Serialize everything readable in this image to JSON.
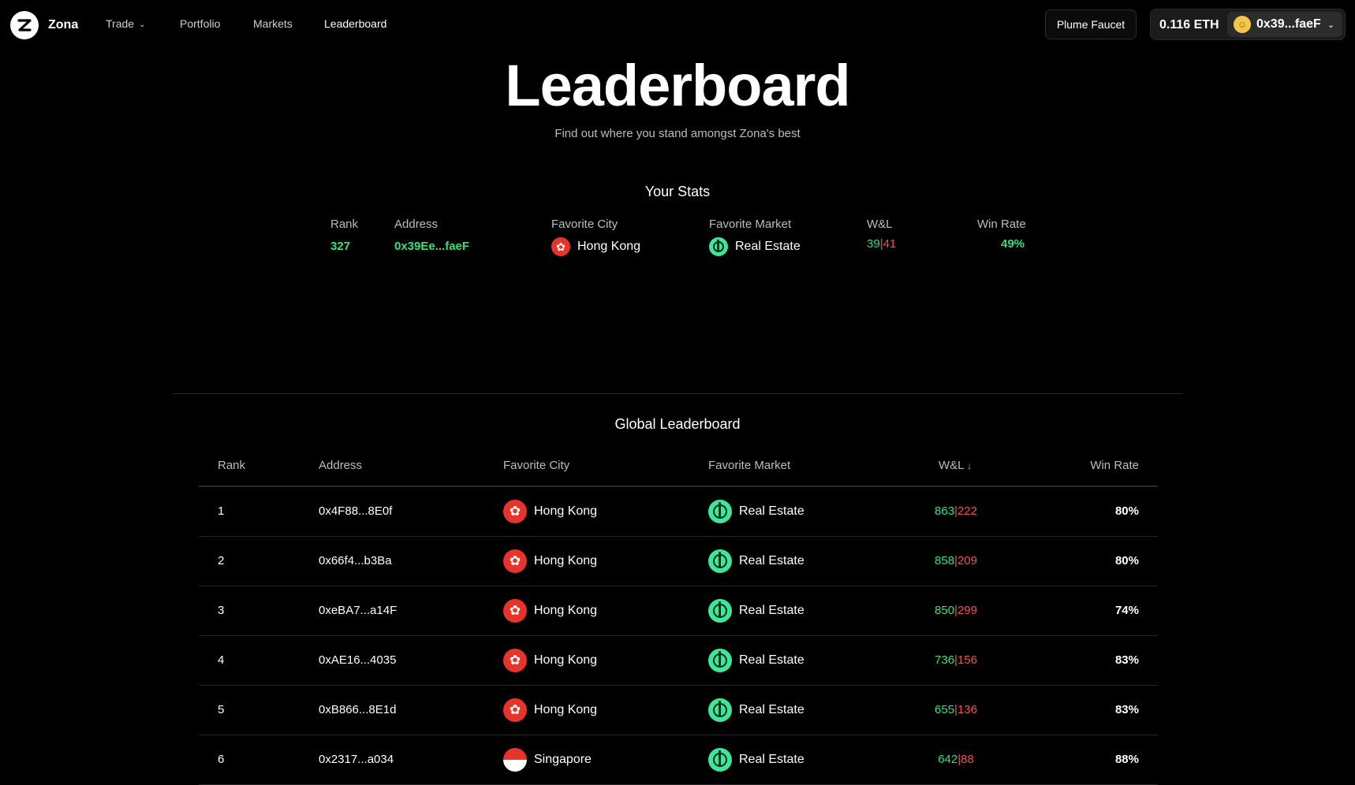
{
  "nav": {
    "brand": "Zona",
    "links": [
      {
        "label": "Trade",
        "has_dropdown": true
      },
      {
        "label": "Portfolio"
      },
      {
        "label": "Markets"
      },
      {
        "label": "Leaderboard",
        "active": true
      }
    ],
    "faucet_label": "Plume Faucet",
    "wallet": {
      "balance": "0.116 ETH",
      "address": "0x39...faeF"
    }
  },
  "hero": {
    "title": "Leaderboard",
    "subtitle": "Find out where you stand amongst Zona's best"
  },
  "your_stats": {
    "title": "Your Stats",
    "labels": {
      "rank": "Rank",
      "address": "Address",
      "city": "Favorite City",
      "market": "Favorite Market",
      "wl": "W&L",
      "rate": "Win Rate"
    },
    "rank": "327",
    "address": "0x39Ee...faeF",
    "city": "Hong Kong",
    "market": "Real Estate",
    "wins": "39",
    "losses": "41",
    "win_rate": "49%"
  },
  "global": {
    "title": "Global Leaderboard",
    "columns": {
      "rank": "Rank",
      "address": "Address",
      "city": "Favorite City",
      "market": "Favorite Market",
      "wl": "W&L",
      "rate": "Win Rate"
    },
    "sort_indicator": "↓",
    "rows": [
      {
        "rank": "1",
        "address": "0x4F88...8E0f",
        "city": "Hong Kong",
        "flag": "hong-kong-flag",
        "market": "Real Estate",
        "wins": "863",
        "losses": "222",
        "win_rate": "80%"
      },
      {
        "rank": "2",
        "address": "0x66f4...b3Ba",
        "city": "Hong Kong",
        "flag": "hong-kong-flag",
        "market": "Real Estate",
        "wins": "858",
        "losses": "209",
        "win_rate": "80%"
      },
      {
        "rank": "3",
        "address": "0xeBA7...a14F",
        "city": "Hong Kong",
        "flag": "hong-kong-flag",
        "market": "Real Estate",
        "wins": "850",
        "losses": "299",
        "win_rate": "74%"
      },
      {
        "rank": "4",
        "address": "0xAE16...4035",
        "city": "Hong Kong",
        "flag": "hong-kong-flag",
        "market": "Real Estate",
        "wins": "736",
        "losses": "156",
        "win_rate": "83%"
      },
      {
        "rank": "5",
        "address": "0xB866...8E1d",
        "city": "Hong Kong",
        "flag": "hong-kong-flag",
        "market": "Real Estate",
        "wins": "655",
        "losses": "136",
        "win_rate": "83%"
      },
      {
        "rank": "6",
        "address": "0x2317...a034",
        "city": "Singapore",
        "flag": "singapore-flag",
        "market": "Real Estate",
        "wins": "642",
        "losses": "88",
        "win_rate": "88%"
      }
    ]
  },
  "colors": {
    "win": "#35e07a",
    "loss": "#f0505a",
    "market_icon": "#3ee69a",
    "flag_red": "#e8332b"
  }
}
